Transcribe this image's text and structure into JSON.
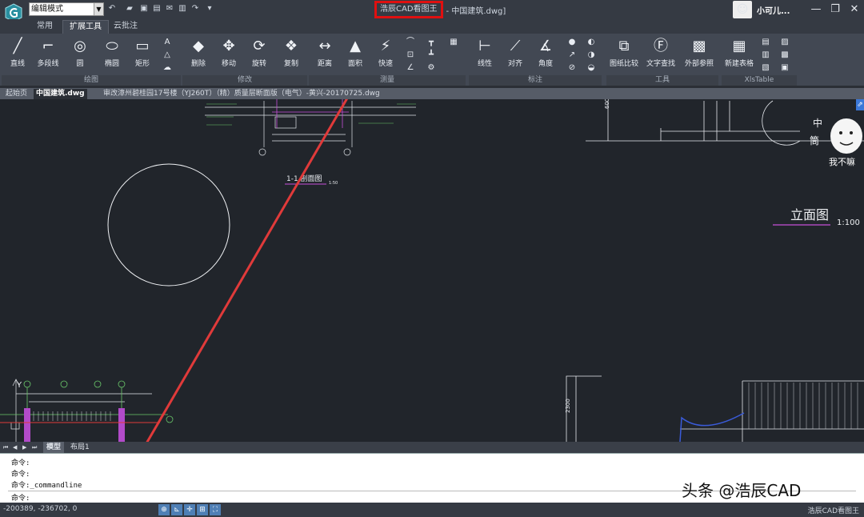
{
  "titlebar": {
    "mode": "编辑模式",
    "app_name": "浩辰CAD看图王",
    "doc_name": "- 中国建筑.dwg]",
    "user_name": "小可儿...",
    "minimize": "—",
    "restore": "❐",
    "close": "✕"
  },
  "ribbon_tabs": [
    "常用",
    "扩展工具",
    "云批注"
  ],
  "ribbon": {
    "draw": {
      "group": "绘图",
      "items": [
        "直线",
        "多段线",
        "圆",
        "椭圆",
        "矩形"
      ]
    },
    "modify": {
      "group": "修改",
      "items": [
        "删除",
        "移动",
        "旋转",
        "复制"
      ]
    },
    "measure": {
      "group": "测量",
      "items": [
        "距离",
        "面积",
        "快速"
      ]
    },
    "annotate": {
      "group": "标注",
      "items": [
        "线性",
        "对齐",
        "角度"
      ]
    },
    "tools": {
      "group": "工具",
      "items": [
        "图纸比较",
        "文字查找",
        "外部参照"
      ]
    },
    "xls": {
      "group": "XlsTable",
      "items": [
        "新建表格"
      ]
    }
  },
  "doc_tabs": [
    "起始页",
    "中国建筑.dwg",
    "审改漳州碧桂园17号楼（YJ260T）（精）质量层断面版（电气）-黄兴-20170725.dwg"
  ],
  "drawing": {
    "section_label": "1-1   剖面图",
    "section_scale": "1:50",
    "elevation_label": "立面图",
    "elevation_scale": "1:100",
    "dim_2300": "2300",
    "dim_600": "600",
    "side_chars": [
      "中",
      "筒"
    ],
    "sticker_text": "我不嘛"
  },
  "layout_tabs": [
    "模型",
    "布局1"
  ],
  "command": {
    "lines": [
      "命令:",
      "命令:",
      "命令:_commandline",
      "命令:"
    ]
  },
  "watermark": "头条 @浩辰CAD",
  "status": {
    "coords": "-200389, -236702, 0",
    "app": "浩辰CAD看图王"
  },
  "colors": {
    "highlight_box": "#e01010",
    "arrow": "#e03a3a",
    "canvas": "#21252b",
    "ribbon": "#424853"
  }
}
